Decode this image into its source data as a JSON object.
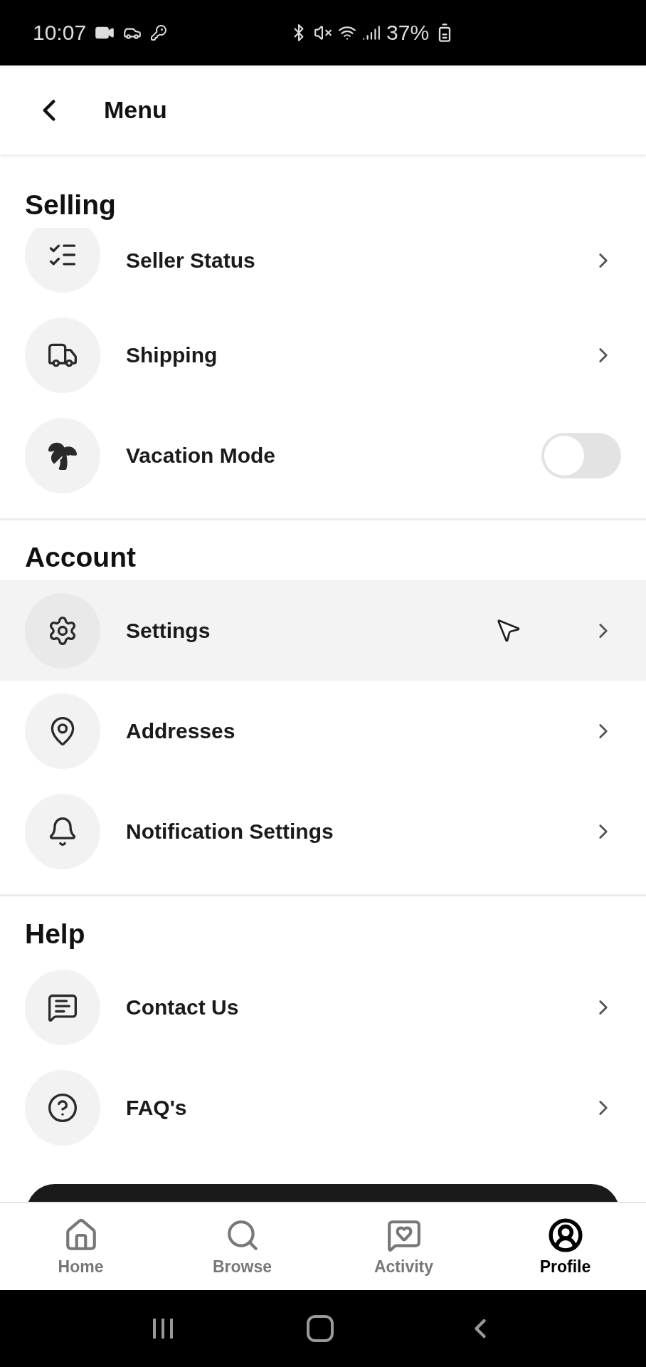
{
  "status_bar": {
    "time": "10:07",
    "battery": "37%"
  },
  "header": {
    "title": "Menu"
  },
  "sections": [
    {
      "title": "Selling",
      "items": [
        {
          "label": "Seller Status",
          "kind": "link",
          "selected": false
        },
        {
          "label": "Shipping",
          "kind": "link",
          "selected": false
        },
        {
          "label": "Vacation Mode",
          "kind": "toggle",
          "on": false,
          "selected": false
        }
      ]
    },
    {
      "title": "Account",
      "items": [
        {
          "label": "Settings",
          "kind": "link",
          "selected": true
        },
        {
          "label": "Addresses",
          "kind": "link",
          "selected": false
        },
        {
          "label": "Notification Settings",
          "kind": "link",
          "selected": false
        }
      ]
    },
    {
      "title": "Help",
      "items": [
        {
          "label": "Contact Us",
          "kind": "link",
          "selected": false
        },
        {
          "label": "FAQ's",
          "kind": "link",
          "selected": false
        }
      ]
    }
  ],
  "nav": [
    {
      "label": "Home",
      "selected": false
    },
    {
      "label": "Browse",
      "selected": false
    },
    {
      "label": "Activity",
      "selected": false
    },
    {
      "label": "Profile",
      "selected": true
    }
  ]
}
